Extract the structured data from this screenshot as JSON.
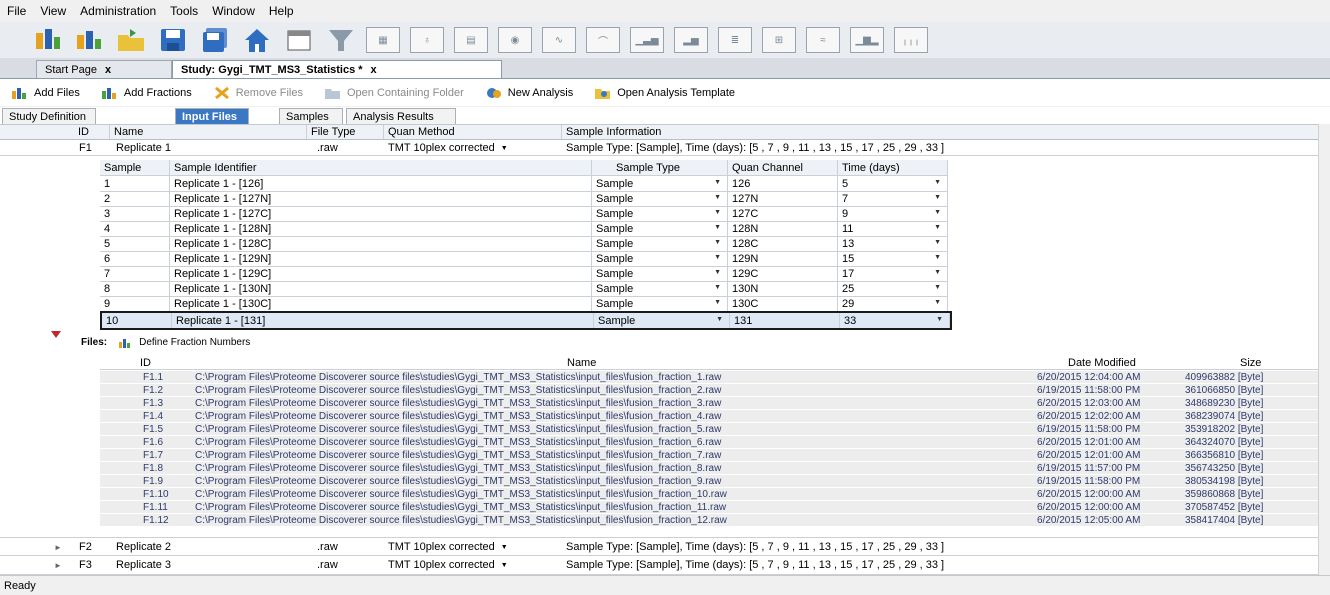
{
  "menu": [
    "File",
    "View",
    "Administration",
    "Tools",
    "Window",
    "Help"
  ],
  "document_tabs": {
    "start_page": "Start Page",
    "study": "Study: Gygi_TMT_MS3_Statistics *",
    "close_glyph": "x"
  },
  "actions": {
    "add_files": "Add Files",
    "add_fractions": "Add Fractions",
    "remove_files": "Remove Files",
    "open_folder": "Open Containing Folder",
    "new_analysis": "New Analysis",
    "open_template": "Open Analysis Template"
  },
  "subtabs": [
    "Study Definition",
    "Input Files",
    "Samples",
    "Analysis Results"
  ],
  "grid": {
    "headers": {
      "id": "ID",
      "name": "Name",
      "file_type": "File Type",
      "quan_method": "Quan Method",
      "sample_info": "Sample Information"
    },
    "files": [
      {
        "id": "F1",
        "name": "Replicate 1",
        "file_type": ".raw",
        "quan_method": "TMT 10plex corrected",
        "sample_info": "Sample Type: [Sample], Time (days): [5 , 7 , 9 , 11 , 13 , 15 , 17 , 25 , 29 , 33 ]"
      },
      {
        "id": "F2",
        "name": "Replicate 2",
        "file_type": ".raw",
        "quan_method": "TMT 10plex corrected",
        "sample_info": "Sample Type: [Sample], Time (days): [5 , 7 , 9 , 11 , 13 , 15 , 17 , 25 , 29 , 33 ]"
      },
      {
        "id": "F3",
        "name": "Replicate 3",
        "file_type": ".raw",
        "quan_method": "TMT 10plex corrected",
        "sample_info": "Sample Type: [Sample], Time (days): [5 , 7 , 9 , 11 , 13 , 15 , 17 , 25 , 29 , 33 ]"
      }
    ]
  },
  "samples": {
    "headers": {
      "sample": "Sample",
      "identifier": "Sample Identifier",
      "type": "Sample Type",
      "channel": "Quan Channel",
      "time": "Time (days)"
    },
    "rows": [
      {
        "sample": "1",
        "identifier": "Replicate 1 - [126]",
        "type": "Sample",
        "channel": "126",
        "time": "5"
      },
      {
        "sample": "2",
        "identifier": "Replicate 1 - [127N]",
        "type": "Sample",
        "channel": "127N",
        "time": "7"
      },
      {
        "sample": "3",
        "identifier": "Replicate 1 - [127C]",
        "type": "Sample",
        "channel": "127C",
        "time": "9"
      },
      {
        "sample": "4",
        "identifier": "Replicate 1 - [128N]",
        "type": "Sample",
        "channel": "128N",
        "time": "11"
      },
      {
        "sample": "5",
        "identifier": "Replicate 1 - [128C]",
        "type": "Sample",
        "channel": "128C",
        "time": "13"
      },
      {
        "sample": "6",
        "identifier": "Replicate 1 - [129N]",
        "type": "Sample",
        "channel": "129N",
        "time": "15"
      },
      {
        "sample": "7",
        "identifier": "Replicate 1 - [129C]",
        "type": "Sample",
        "channel": "129C",
        "time": "17"
      },
      {
        "sample": "8",
        "identifier": "Replicate 1 - [130N]",
        "type": "Sample",
        "channel": "130N",
        "time": "25"
      },
      {
        "sample": "9",
        "identifier": "Replicate 1 - [130C]",
        "type": "Sample",
        "channel": "130C",
        "time": "29"
      },
      {
        "sample": "10",
        "identifier": "Replicate 1 - [131]",
        "type": "Sample",
        "channel": "131",
        "time": "33"
      }
    ]
  },
  "fractions": {
    "label": "Files:",
    "define_label": "Define Fraction Numbers",
    "headers": {
      "id": "ID",
      "name": "Name",
      "date": "Date Modified",
      "size": "Size"
    },
    "rows": [
      {
        "id": "F1.1",
        "name": "C:\\Program Files\\Proteome Discoverer source files\\studies\\Gygi_TMT_MS3_Statistics\\input_files\\fusion_fraction_1.raw",
        "date": "6/20/2015 12:04:00 AM",
        "size": "409963882 [Byte]"
      },
      {
        "id": "F1.2",
        "name": "C:\\Program Files\\Proteome Discoverer source files\\studies\\Gygi_TMT_MS3_Statistics\\input_files\\fusion_fraction_2.raw",
        "date": "6/19/2015 11:58:00 PM",
        "size": "361066850 [Byte]"
      },
      {
        "id": "F1.3",
        "name": "C:\\Program Files\\Proteome Discoverer source files\\studies\\Gygi_TMT_MS3_Statistics\\input_files\\fusion_fraction_3.raw",
        "date": "6/20/2015 12:03:00 AM",
        "size": "348689230 [Byte]"
      },
      {
        "id": "F1.4",
        "name": "C:\\Program Files\\Proteome Discoverer source files\\studies\\Gygi_TMT_MS3_Statistics\\input_files\\fusion_fraction_4.raw",
        "date": "6/20/2015 12:02:00 AM",
        "size": "368239074 [Byte]"
      },
      {
        "id": "F1.5",
        "name": "C:\\Program Files\\Proteome Discoverer source files\\studies\\Gygi_TMT_MS3_Statistics\\input_files\\fusion_fraction_5.raw",
        "date": "6/19/2015 11:58:00 PM",
        "size": "353918202 [Byte]"
      },
      {
        "id": "F1.6",
        "name": "C:\\Program Files\\Proteome Discoverer source files\\studies\\Gygi_TMT_MS3_Statistics\\input_files\\fusion_fraction_6.raw",
        "date": "6/20/2015 12:01:00 AM",
        "size": "364324070 [Byte]"
      },
      {
        "id": "F1.7",
        "name": "C:\\Program Files\\Proteome Discoverer source files\\studies\\Gygi_TMT_MS3_Statistics\\input_files\\fusion_fraction_7.raw",
        "date": "6/20/2015 12:01:00 AM",
        "size": "366356810 [Byte]"
      },
      {
        "id": "F1.8",
        "name": "C:\\Program Files\\Proteome Discoverer source files\\studies\\Gygi_TMT_MS3_Statistics\\input_files\\fusion_fraction_8.raw",
        "date": "6/19/2015 11:57:00 PM",
        "size": "356743250 [Byte]"
      },
      {
        "id": "F1.9",
        "name": "C:\\Program Files\\Proteome Discoverer source files\\studies\\Gygi_TMT_MS3_Statistics\\input_files\\fusion_fraction_9.raw",
        "date": "6/19/2015 11:58:00 PM",
        "size": "380534198 [Byte]"
      },
      {
        "id": "F1.10",
        "name": "C:\\Program Files\\Proteome Discoverer source files\\studies\\Gygi_TMT_MS3_Statistics\\input_files\\fusion_fraction_10.raw",
        "date": "6/20/2015 12:00:00 AM",
        "size": "359860868 [Byte]"
      },
      {
        "id": "F1.11",
        "name": "C:\\Program Files\\Proteome Discoverer source files\\studies\\Gygi_TMT_MS3_Statistics\\input_files\\fusion_fraction_11.raw",
        "date": "6/20/2015 12:00:00 AM",
        "size": "370587452 [Byte]"
      },
      {
        "id": "F1.12",
        "name": "C:\\Program Files\\Proteome Discoverer source files\\studies\\Gygi_TMT_MS3_Statistics\\input_files\\fusion_fraction_12.raw",
        "date": "6/20/2015 12:05:00 AM",
        "size": "358417404 [Byte]"
      }
    ]
  },
  "status": "Ready",
  "colors": {
    "selected_tab": "#3b78c4",
    "file_row_bg": "#ededed",
    "file_text": "#2d3b6a"
  }
}
